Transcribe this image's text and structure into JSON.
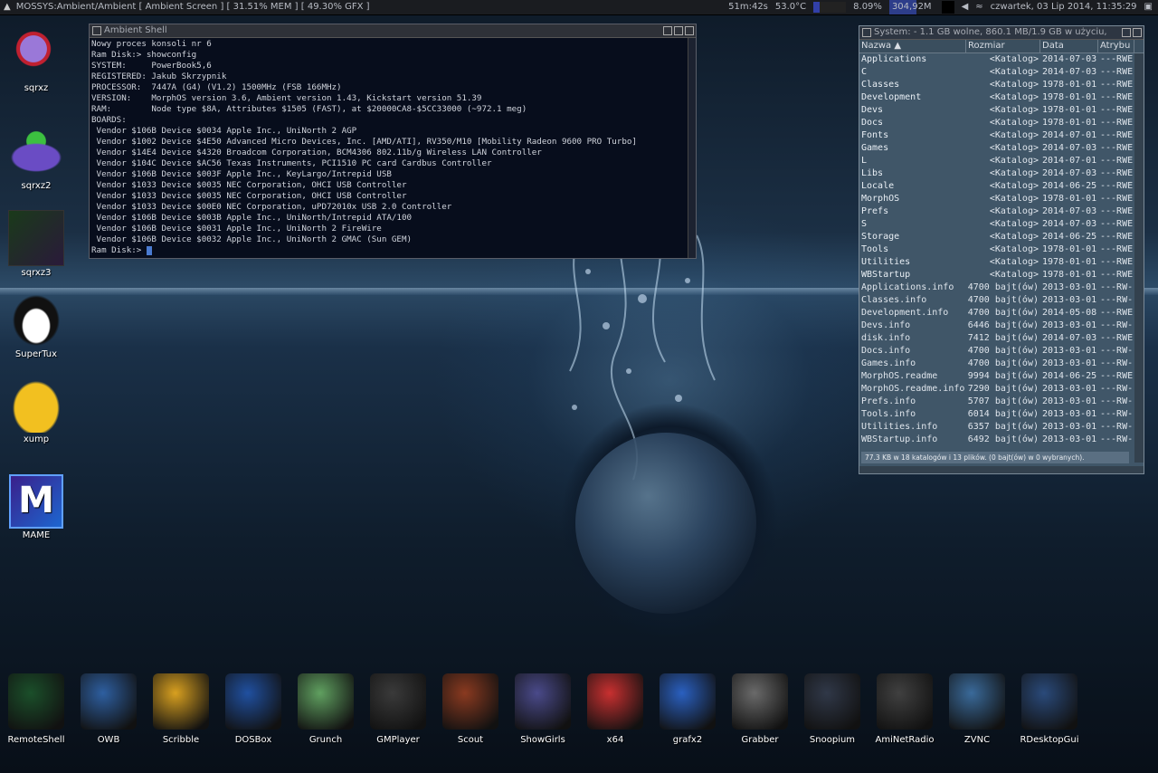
{
  "topbar": {
    "title": "MOSSYS:Ambient/Ambient [ Ambient Screen ] [ 31.51% MEM ] [ 49.30% GFX ]",
    "uptime": "51m:42s",
    "temp": "53.0°C",
    "cpu": "8.09%",
    "mem": "304,92M",
    "clock": "czwartek, 03 Lip 2014, 11:35:29"
  },
  "desktop_icons": [
    {
      "label": "sqrxz"
    },
    {
      "label": "sqrxz2"
    },
    {
      "label": "sqrxz3"
    },
    {
      "label": "SuperTux"
    },
    {
      "label": "xump"
    },
    {
      "label": "MAME"
    }
  ],
  "shell": {
    "title": "Ambient Shell",
    "lines": [
      "Nowy proces konsoli nr 6",
      "Ram Disk:> showconfig",
      "SYSTEM:     PowerBook5,6",
      "REGISTERED: Jakub Skrzypnik",
      "PROCESSOR:  7447A (G4) (V1.2) 1500MHz (FSB 166MHz)",
      "VERSION:    MorphOS version 3.6, Ambient version 1.43, Kickstart version 51.39",
      "RAM:        Node type $8A, Attributes $1505 (FAST), at $20000CA8-$5CC33000 (~972.1 meg)",
      "BOARDS:",
      " Vendor $106B Device $0034 Apple Inc., UniNorth 2 AGP",
      " Vendor $1002 Device $4E50 Advanced Micro Devices, Inc. [AMD/ATI], RV350/M10 [Mobility Radeon 9600 PRO Turbo]",
      " Vendor $14E4 Device $4320 Broadcom Corporation, BCM4306 802.11b/g Wireless LAN Controller",
      " Vendor $104C Device $AC56 Texas Instruments, PCI1510 PC card Cardbus Controller",
      " Vendor $106B Device $003F Apple Inc., KeyLargo/Intrepid USB",
      " Vendor $1033 Device $0035 NEC Corporation, OHCI USB Controller",
      " Vendor $1033 Device $0035 NEC Corporation, OHCI USB Controller",
      " Vendor $1033 Device $00E0 NEC Corporation, uPD72010x USB 2.0 Controller",
      " Vendor $106B Device $003B Apple Inc., UniNorth/Intrepid ATA/100",
      " Vendor $106B Device $0031 Apple Inc., UniNorth 2 FireWire",
      " Vendor $106B Device $0032 Apple Inc., UniNorth 2 GMAC (Sun GEM)"
    ],
    "prompt": "Ram Disk:> "
  },
  "system_window": {
    "title": "System: - 1.1 GB wolne, 860.1 MB/1.9 GB w użyciu, 4",
    "columns": [
      "Nazwa",
      "Rozmiar",
      "Data",
      "Atrybu"
    ],
    "rows": [
      {
        "name": "Applications",
        "size": "<Katalog>",
        "date": "2014-07-03",
        "attr": "---RWE"
      },
      {
        "name": "C",
        "size": "<Katalog>",
        "date": "2014-07-03",
        "attr": "---RWE"
      },
      {
        "name": "Classes",
        "size": "<Katalog>",
        "date": "1978-01-01",
        "attr": "---RWE"
      },
      {
        "name": "Development",
        "size": "<Katalog>",
        "date": "1978-01-01",
        "attr": "---RWE"
      },
      {
        "name": "Devs",
        "size": "<Katalog>",
        "date": "1978-01-01",
        "attr": "---RWE"
      },
      {
        "name": "Docs",
        "size": "<Katalog>",
        "date": "1978-01-01",
        "attr": "---RWE"
      },
      {
        "name": "Fonts",
        "size": "<Katalog>",
        "date": "2014-07-01",
        "attr": "---RWE"
      },
      {
        "name": "Games",
        "size": "<Katalog>",
        "date": "2014-07-03",
        "attr": "---RWE"
      },
      {
        "name": "L",
        "size": "<Katalog>",
        "date": "2014-07-01",
        "attr": "---RWE"
      },
      {
        "name": "Libs",
        "size": "<Katalog>",
        "date": "2014-07-03",
        "attr": "---RWE"
      },
      {
        "name": "Locale",
        "size": "<Katalog>",
        "date": "2014-06-25",
        "attr": "---RWE"
      },
      {
        "name": "MorphOS",
        "size": "<Katalog>",
        "date": "1978-01-01",
        "attr": "---RWE"
      },
      {
        "name": "Prefs",
        "size": "<Katalog>",
        "date": "2014-07-03",
        "attr": "---RWE"
      },
      {
        "name": "S",
        "size": "<Katalog>",
        "date": "2014-07-03",
        "attr": "---RWE"
      },
      {
        "name": "Storage",
        "size": "<Katalog>",
        "date": "2014-06-25",
        "attr": "---RWE"
      },
      {
        "name": "Tools",
        "size": "<Katalog>",
        "date": "1978-01-01",
        "attr": "---RWE"
      },
      {
        "name": "Utilities",
        "size": "<Katalog>",
        "date": "1978-01-01",
        "attr": "---RWE"
      },
      {
        "name": "WBStartup",
        "size": "<Katalog>",
        "date": "1978-01-01",
        "attr": "---RWE"
      },
      {
        "name": "Applications.info",
        "size": "4700 bajt(ów)",
        "date": "2013-03-01",
        "attr": "---RW-"
      },
      {
        "name": "Classes.info",
        "size": "4700 bajt(ów)",
        "date": "2013-03-01",
        "attr": "---RW-"
      },
      {
        "name": "Development.info",
        "size": "4700 bajt(ów)",
        "date": "2014-05-08",
        "attr": "---RWE"
      },
      {
        "name": "Devs.info",
        "size": "6446 bajt(ów)",
        "date": "2013-03-01",
        "attr": "---RW-"
      },
      {
        "name": "disk.info",
        "size": "7412 bajt(ów)",
        "date": "2014-07-03",
        "attr": "---RWE"
      },
      {
        "name": "Docs.info",
        "size": "4700 bajt(ów)",
        "date": "2013-03-01",
        "attr": "---RW-"
      },
      {
        "name": "Games.info",
        "size": "4700 bajt(ów)",
        "date": "2013-03-01",
        "attr": "---RW-"
      },
      {
        "name": "MorphOS.readme",
        "size": "9994 bajt(ów)",
        "date": "2014-06-25",
        "attr": "---RWE"
      },
      {
        "name": "MorphOS.readme.info",
        "size": "7290 bajt(ów)",
        "date": "2013-03-01",
        "attr": "---RW-"
      },
      {
        "name": "Prefs.info",
        "size": "5707 bajt(ów)",
        "date": "2013-03-01",
        "attr": "---RW-"
      },
      {
        "name": "Tools.info",
        "size": "6014 bajt(ów)",
        "date": "2013-03-01",
        "attr": "---RW-"
      },
      {
        "name": "Utilities.info",
        "size": "6357 bajt(ów)",
        "date": "2013-03-01",
        "attr": "---RW-"
      },
      {
        "name": "WBStartup.info",
        "size": "6492 bajt(ów)",
        "date": "2013-03-01",
        "attr": "---RW-"
      }
    ],
    "status": "77.3 KB w 18 katalogów i 13 plików. (0 bajt(ów) w 0 wybranych)."
  },
  "dock": [
    {
      "label": "RemoteShell"
    },
    {
      "label": "OWB"
    },
    {
      "label": "Scribble"
    },
    {
      "label": "DOSBox"
    },
    {
      "label": "Grunch"
    },
    {
      "label": "GMPlayer"
    },
    {
      "label": "Scout"
    },
    {
      "label": "ShowGirls"
    },
    {
      "label": "x64"
    },
    {
      "label": "grafx2"
    },
    {
      "label": "Grabber"
    },
    {
      "label": "Snoopium"
    },
    {
      "label": "AmiNetRadio"
    },
    {
      "label": "ZVNC"
    },
    {
      "label": "RDesktopGui"
    }
  ]
}
